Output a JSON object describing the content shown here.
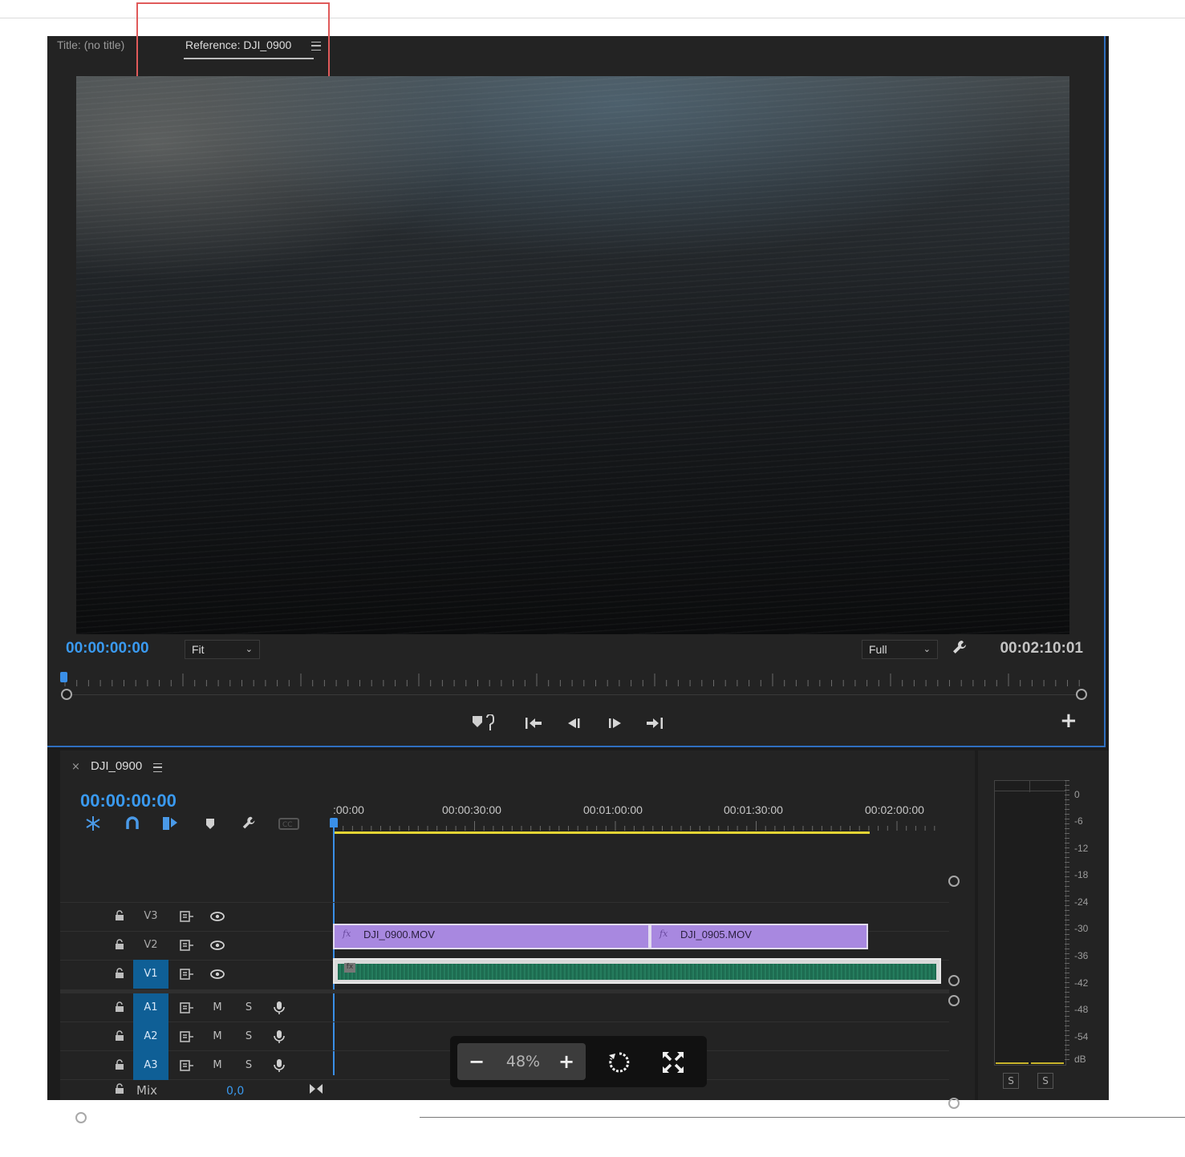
{
  "monitor": {
    "tab_title": "Title: (no title)",
    "tab_reference": "Reference: DJI_0900",
    "timecode_current": "00:00:00:00",
    "timecode_duration": "00:02:10:01",
    "zoom_select": "Fit",
    "resolution_select": "Full",
    "icons": [
      "menu-icon",
      "wrench-icon",
      "marker-link-icon",
      "go-to-in-icon",
      "step-back-icon",
      "step-forward-icon",
      "go-to-out-icon",
      "add-button-icon"
    ]
  },
  "timeline": {
    "sequence_name": "DJI_0900",
    "close_glyph": "×",
    "timecode": "00:00:00:00",
    "ruler_labels": [
      ":00:00",
      "00:00:30:00",
      "00:01:00:00",
      "00:01:30:00",
      "00:02:00:00"
    ],
    "tools": [
      "snap-icon",
      "magnet-icon",
      "linked-selection-icon",
      "marker-icon",
      "wrench-icon",
      "captions-icon"
    ],
    "video_tracks": [
      {
        "label": "V3",
        "active": false
      },
      {
        "label": "V2",
        "active": false
      },
      {
        "label": "V1",
        "active": true
      }
    ],
    "audio_tracks": [
      {
        "label": "A1",
        "mute": "M",
        "solo": "S",
        "active": true
      },
      {
        "label": "A2",
        "mute": "M",
        "solo": "S",
        "active": true
      },
      {
        "label": "A3",
        "mute": "M",
        "solo": "S",
        "active": true
      }
    ],
    "mix": {
      "label": "Mix",
      "value": "0,0"
    },
    "clips": {
      "video": [
        {
          "name": "DJI_0900.MOV",
          "fx": "fx"
        },
        {
          "name": "DJI_0905.MOV",
          "fx": "fx"
        }
      ],
      "audio": [
        {
          "fx": "fx"
        }
      ]
    }
  },
  "zoom_overlay": {
    "minus": "−",
    "value": "48%",
    "plus": "+"
  },
  "meter": {
    "db_labels": [
      "0",
      "-6",
      "-12",
      "-18",
      "-24",
      "-30",
      "-36",
      "-42",
      "-48",
      "-54",
      "dB"
    ],
    "solo_left": "S",
    "solo_right": "S"
  },
  "colors": {
    "accent_blue": "#3a9af0",
    "clip_video": "#a888e0",
    "clip_audio_wave": "#1e6e52",
    "work_area_bar": "#e4d534",
    "highlight_box": "#e05a5a"
  }
}
